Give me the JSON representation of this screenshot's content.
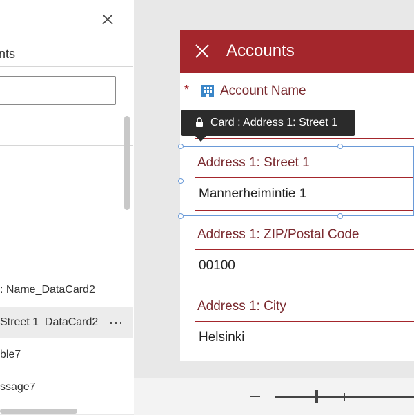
{
  "panel": {
    "title": "nts",
    "tree_items": [
      {
        "label": ": Name_DataCard2",
        "selected": false
      },
      {
        "label": "Street 1_DataCard2",
        "selected": true,
        "more": "···"
      },
      {
        "label": "ble7",
        "selected": false
      },
      {
        "label": "ssage7",
        "selected": false
      }
    ]
  },
  "form": {
    "title": "Accounts",
    "account_name_label": "Account Name",
    "required_marker": "*",
    "fields": [
      {
        "label": "Address 1: Street 1",
        "value": "Mannerheimintie 1"
      },
      {
        "label": "Address 1: ZIP/Postal Code",
        "value": "00100"
      },
      {
        "label": "Address 1: City",
        "value": "Helsinki"
      }
    ]
  },
  "tooltip": {
    "text": "Card : Address 1: Street 1",
    "icon": "lock-icon"
  },
  "colors": {
    "header": "#a4262c",
    "label": "#7a2a2f",
    "selection": "#6a9ad8"
  }
}
